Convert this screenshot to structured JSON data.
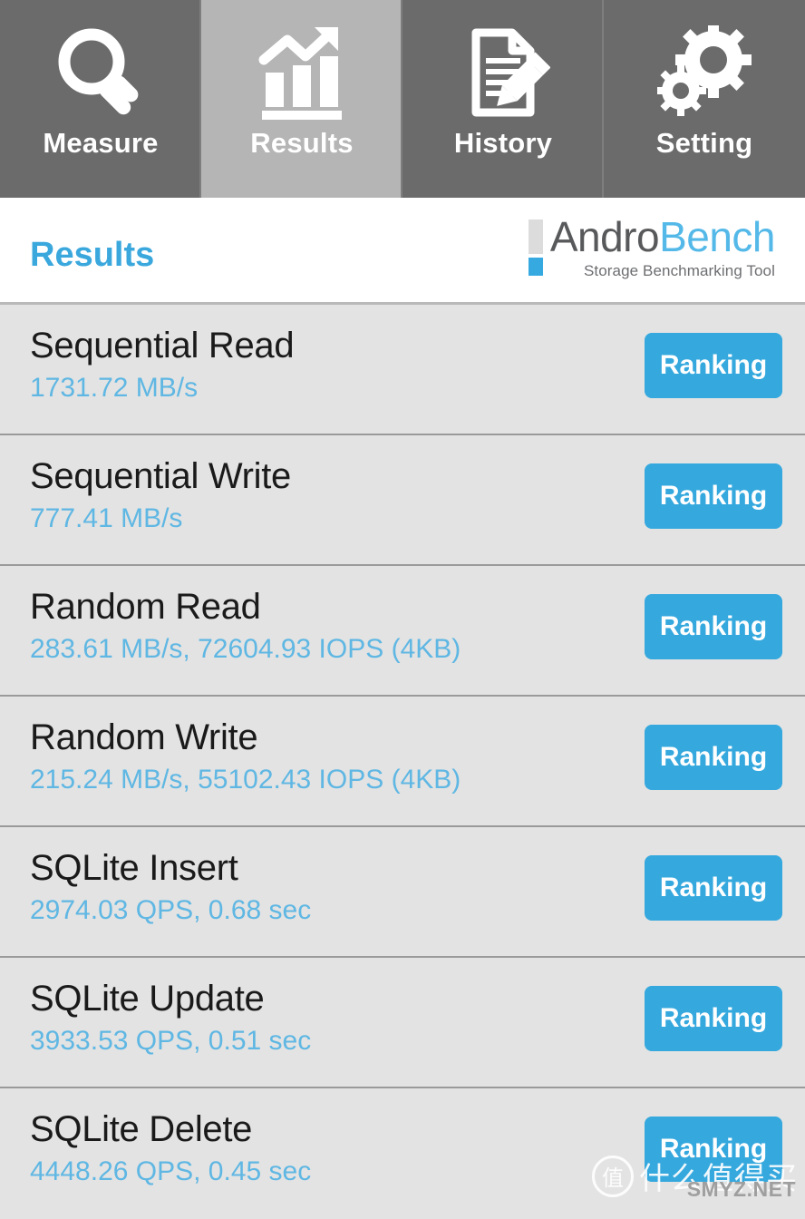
{
  "tabs": [
    {
      "label": "Measure",
      "icon": "magnifier-icon",
      "selected": false
    },
    {
      "label": "Results",
      "icon": "bar-chart-arrow-icon",
      "selected": true
    },
    {
      "label": "History",
      "icon": "document-pencil-icon",
      "selected": false
    },
    {
      "label": "Setting",
      "icon": "gears-icon",
      "selected": false
    }
  ],
  "header": {
    "page_title": "Results",
    "brand_part1": "Andro",
    "brand_part2": "Bench",
    "brand_subtitle": "Storage Benchmarking Tool"
  },
  "results": [
    {
      "title": "Sequential Read",
      "value": "1731.72 MB/s",
      "button": "Ranking"
    },
    {
      "title": "Sequential Write",
      "value": "777.41 MB/s",
      "button": "Ranking"
    },
    {
      "title": "Random Read",
      "value": "283.61 MB/s, 72604.93 IOPS (4KB)",
      "button": "Ranking"
    },
    {
      "title": "Random Write",
      "value": "215.24 MB/s, 55102.43 IOPS (4KB)",
      "button": "Ranking"
    },
    {
      "title": "SQLite Insert",
      "value": "2974.03 QPS, 0.68 sec",
      "button": "Ranking"
    },
    {
      "title": "SQLite Update",
      "value": "3933.53 QPS, 0.51 sec",
      "button": "Ranking"
    },
    {
      "title": "SQLite Delete",
      "value": "4448.26 QPS, 0.45 sec",
      "button": "Ranking"
    }
  ],
  "watermark": {
    "badge": "值",
    "cn_text": "什么值得买",
    "domain": "SMYZ.NET"
  },
  "colors": {
    "accent_blue": "#35a8de",
    "value_blue": "#5fb7e3",
    "title_blue": "#3ba8dd",
    "brand_gray": "#58595b",
    "tab_bg": "#6b6b6b",
    "tab_selected_bg": "#b5b5b5",
    "row_bg": "#e3e3e3",
    "divider": "#9a9a9a"
  }
}
